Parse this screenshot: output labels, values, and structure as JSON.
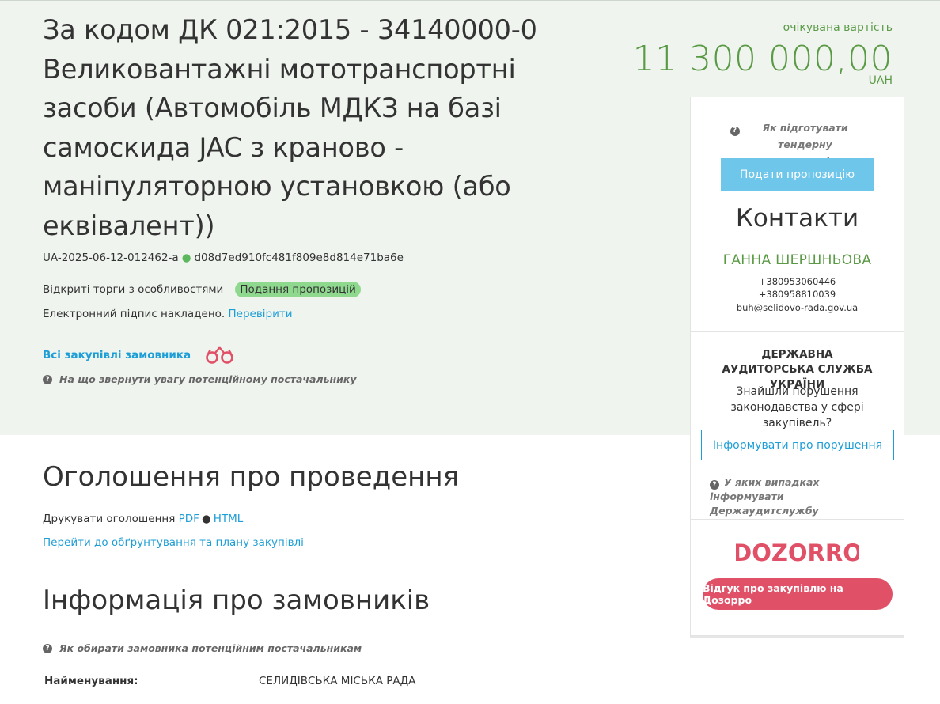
{
  "tender": {
    "title": "За кодом ДК 021:2015 - 34140000-0 Великовантажні мототранспортні засоби (Автомобіль МДКЗ на базі самоскида JAC з крановo - маніпуляторною установкою (або еквівалент))",
    "id": "UA-2025-06-12-012462-a",
    "hash": "d08d7ed910fc481f809e8d814e71ba6e",
    "procedure": "Відкриті торги з особливостями",
    "status": "Подання пропозицій",
    "signature_text": "Електронний підпис накладено.",
    "signature_link": "Перевірити",
    "all_purchases": "Всі закупівлі замовника",
    "help_supplier": "На що звернути увагу потенційному постачальнику"
  },
  "price": {
    "label": "очікувана вартість",
    "value": "11 300 000,00",
    "currency": "UAH"
  },
  "sidebar": {
    "help_prepare": "Як підготувати тендерну пропозицію",
    "submit_label": "Подати пропозицію",
    "contacts_title": "Контакти",
    "contact_name": "ГАННА ШЕРШНЬОВА",
    "phones": [
      "+380953060446",
      "+380958810039"
    ],
    "email": "buh@selidovo-rada.gov.ua",
    "audit_title": "ДЕРЖАВНА АУДИТОРСЬКА СЛУЖБА УКРАЇНИ",
    "audit_text": "Знайшли порушення законодавства у сфері закупівель?",
    "inform_label": "Інформувати про порушення",
    "audit_help": "У яких випадках інформувати Держаудитслужбу",
    "dozorro_logo": "DOZORRO",
    "dozorro_button": "Відгук про закупівлю на Дозорро"
  },
  "announcement": {
    "title": "Оголошення про проведення",
    "print_text": "Друкувати оголошення",
    "pdf": "PDF",
    "html": "HTML",
    "plan_link": "Перейти до обґрунтування та плану закупівлі"
  },
  "customers": {
    "title": "Інформація про замовників",
    "help": "Як обирати замовника потенційним постачальникам",
    "name_label": "Найменування:",
    "name_value": "СЕЛИДІВСЬКА МІСЬКА РАДА"
  },
  "colors": {
    "hero_bg": "#eff4ef",
    "accent_green": "#5a9a45",
    "link_blue": "#1e9ed6",
    "status_green": "#8fd98f",
    "submit_blue": "#6ec6ea",
    "dozorro_red": "#e05067"
  },
  "icons": [
    "question-icon",
    "binoculars-icon",
    "dozorro-logo"
  ]
}
